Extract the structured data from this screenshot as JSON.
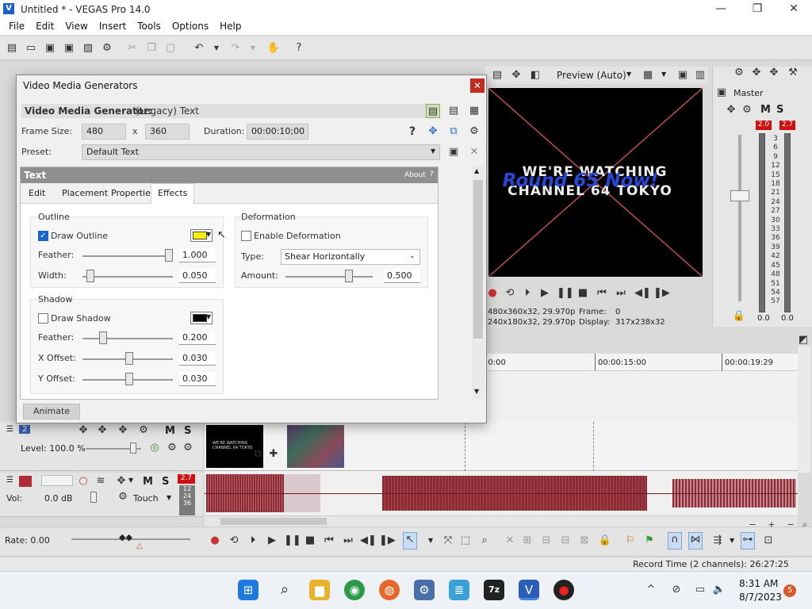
{
  "window": {
    "title": "Untitled * - VEGAS Pro 14.0",
    "minimize": "—",
    "restore": "❐",
    "close": "✕"
  },
  "menu": [
    "File",
    "Edit",
    "View",
    "Insert",
    "Tools",
    "Options",
    "Help"
  ],
  "preview": {
    "mode": "Preview (Auto)",
    "line1": "WE'RE WATCHING",
    "line2": "CHANNEL 64 TOKYO",
    "overlay": "Round 65 Now!",
    "project_info": "480x360x32, 29.970p",
    "preview_info": "240x180x32, 29.970p",
    "frame_label": "Frame:",
    "frame_value": "0",
    "display_label": "Display:",
    "display_value": "317x238x32"
  },
  "master": {
    "title": "Master",
    "m": "M",
    "s": "S",
    "peak_left": "2.0",
    "peak_right": "2.7",
    "scale": [
      "3",
      "6",
      "9",
      "12",
      "15",
      "18",
      "21",
      "24",
      "27",
      "30",
      "33",
      "36",
      "39",
      "42",
      "45",
      "48",
      "51",
      "54",
      "57"
    ],
    "level_left": "0.0",
    "level_right": "0.0"
  },
  "timeline": {
    "markers": [
      "00:00:15:00",
      "00:00:19:29"
    ],
    "marker_partial": ":0:00"
  },
  "video_track": {
    "number": "2",
    "level": "Level: 100.0 %",
    "m": "M",
    "s": "S"
  },
  "audio_track": {
    "vol": "Vol:",
    "vol_value": "0.0 dB",
    "peak": "2.7",
    "m": "M",
    "s": "S",
    "touch": "Touch",
    "meter_vals": [
      "12",
      "24",
      "36"
    ]
  },
  "bottom": {
    "rate": "Rate: 0.00"
  },
  "status": {
    "record_time": "Record Time (2 channels): 26:27:25"
  },
  "taskbar": {
    "time": "8:31 AM",
    "date": "8/7/2023",
    "badge": "5"
  },
  "dialog": {
    "title": "Video Media Generators",
    "close": "✕",
    "generator_label": "Video Media Generator:",
    "generator_name": "(Legacy) Text",
    "frame_size_label": "Frame Size:",
    "width": "480",
    "x": "x",
    "height": "360",
    "duration_label": "Duration:",
    "duration": "00:00:10;00",
    "preset_label": "Preset:",
    "preset": "Default Text",
    "plugin_title": "Text",
    "about": "About",
    "about_q": "?",
    "tabs": [
      "Edit",
      "Placement",
      "Properties",
      "Effects"
    ],
    "animate": "Animate",
    "outline": {
      "title": "Outline",
      "draw_label": "Draw Outline",
      "draw_checked": true,
      "color": "#f2f200",
      "feather_label": "Feather:",
      "feather_value": "1.000",
      "feather_level": 1.0,
      "width_label": "Width:",
      "width_value": "0.050",
      "width_level": 0.05
    },
    "shadow": {
      "title": "Shadow",
      "draw_label": "Draw Shadow",
      "draw_checked": false,
      "color": "#000000",
      "feather_label": "Feather:",
      "feather_value": "0.200",
      "feather_level": 0.2,
      "xoffset_label": "X Offset:",
      "xoffset_value": "0.030",
      "xoffset_level": 0.515,
      "yoffset_label": "Y Offset:",
      "yoffset_value": "0.030",
      "yoffset_level": 0.515
    },
    "deformation": {
      "title": "Deformation",
      "enable_label": "Enable Deformation",
      "enable_checked": false,
      "type_label": "Type:",
      "type_value": "Shear Horizontally",
      "amount_label": "Amount:",
      "amount_value": "0.500",
      "amount_level": 0.75
    }
  }
}
